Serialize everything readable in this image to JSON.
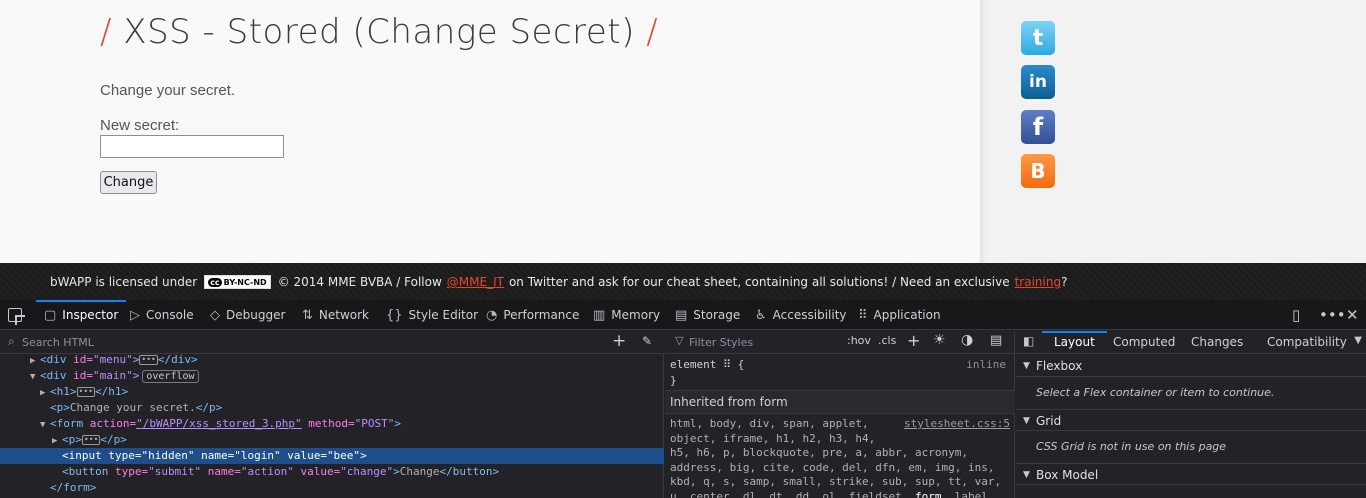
{
  "page": {
    "title_main": "XSS - Stored (Change Secret)",
    "title_slash": "/",
    "intro": "Change your secret.",
    "secret_label": "New secret:",
    "secret_value": "",
    "change_button": "Change"
  },
  "social": {
    "twitter": "t",
    "linkedin": "in",
    "facebook": "f",
    "blogger": "B"
  },
  "footer": {
    "licensed": "bWAPP is licensed under",
    "cc_symbol": "cc",
    "cc_badge": "BY-NC-ND",
    "copyright": "© 2014 MME BVBA / Follow",
    "twitter_handle": "@MME_IT",
    "cheat_text": "on Twitter and ask for our cheat sheet, containing all solutions! / Need an exclusive",
    "training_link": "training",
    "end_mark": "?"
  },
  "devtools": {
    "tabs": [
      {
        "label": "Inspector",
        "icon": "▢"
      },
      {
        "label": "Console",
        "icon": "▷"
      },
      {
        "label": "Debugger",
        "icon": "◇"
      },
      {
        "label": "Network",
        "icon": "⇅"
      },
      {
        "label": "Style Editor",
        "icon": "{}"
      },
      {
        "label": "Performance",
        "icon": "◔"
      },
      {
        "label": "Memory",
        "icon": "▥"
      },
      {
        "label": "Storage",
        "icon": "▤"
      },
      {
        "label": "Accessibility",
        "icon": "♿"
      },
      {
        "label": "Application",
        "icon": "⠿"
      }
    ],
    "search_placeholder": "Search HTML",
    "markup": {
      "l1_tag": "<div ",
      "l1_attr": "id=",
      "l1_val": "\"menu\"",
      "l1_close": "</div>",
      "l2_tag": "<div ",
      "l2_attr": "id=",
      "l2_val": "\"main\"",
      "l2_end": ">",
      "l2_badge": "overflow",
      "l3_open": "<h1>",
      "l3_close": "</h1>",
      "l4_open": "<p>",
      "l4_text": "Change your secret.",
      "l4_close": "</p>",
      "l5_tag": "<form ",
      "l5_attr1": "action=",
      "l5_val1": "\"/bWAPP/xss_stored_3.php\"",
      "l5_attr2": " method=",
      "l5_val2": "\"POST\"",
      "l5_end": ">",
      "l6_open": "<p>",
      "l6_close": "</p>",
      "l7_tag": "<input ",
      "l7_attr1": "type=",
      "l7_val1": "\"hidden\"",
      "l7_attr2": " name=",
      "l7_val2": "\"login\"",
      "l7_attr3": " value=",
      "l7_val3": "\"bee\"",
      "l7_end": ">",
      "l8_tag": "<button ",
      "l8_attr1": "type=",
      "l8_val1": "\"submit\"",
      "l8_attr2": " name=",
      "l8_val2": "\"action\"",
      "l8_attr3": " value=",
      "l8_val3": "\"change\"",
      "l8_end": ">",
      "l8_text": "Change",
      "l8_close": "</button>",
      "l9_close": "</form>"
    },
    "rules": {
      "filter_placeholder": "Filter Styles",
      "hov": ":hov",
      "cls": ".cls",
      "element_open": "element",
      "element_brace": "{",
      "element_close": "}",
      "inline": "inline",
      "inherited": "Inherited from form",
      "sel1": "html, body, div, span, applet,",
      "sel2": "object, iframe, h1, h2, h3, h4,",
      "sel3": "h5, h6, p, blockquote, pre, a, abbr, acronym,",
      "sel4": "address, big, cite, code, del, dfn, em, img, ins,",
      "sel5": "kbd, q, s, samp, small, strike, sub, sup, tt, var,",
      "sel6_pre": "u, center, dl, dt, dd, ol, fieldset, ",
      "sel6_bold": "form",
      "sel6_post": ", label,",
      "source": "stylesheet.css:5"
    },
    "layout": {
      "tabs": [
        "Layout",
        "Computed",
        "Changes",
        "Compatibility"
      ],
      "flexbox_head": "Flexbox",
      "flexbox_body": "Select a Flex container or item to continue.",
      "grid_head": "Grid",
      "grid_body": "CSS Grid is not in use on this page",
      "box_head": "Box Model"
    }
  },
  "colors": {
    "accent": "#e4482a",
    "devtools_bg": "#232327",
    "selection": "#204e8a",
    "tab_indicator": "#0a84ff"
  }
}
